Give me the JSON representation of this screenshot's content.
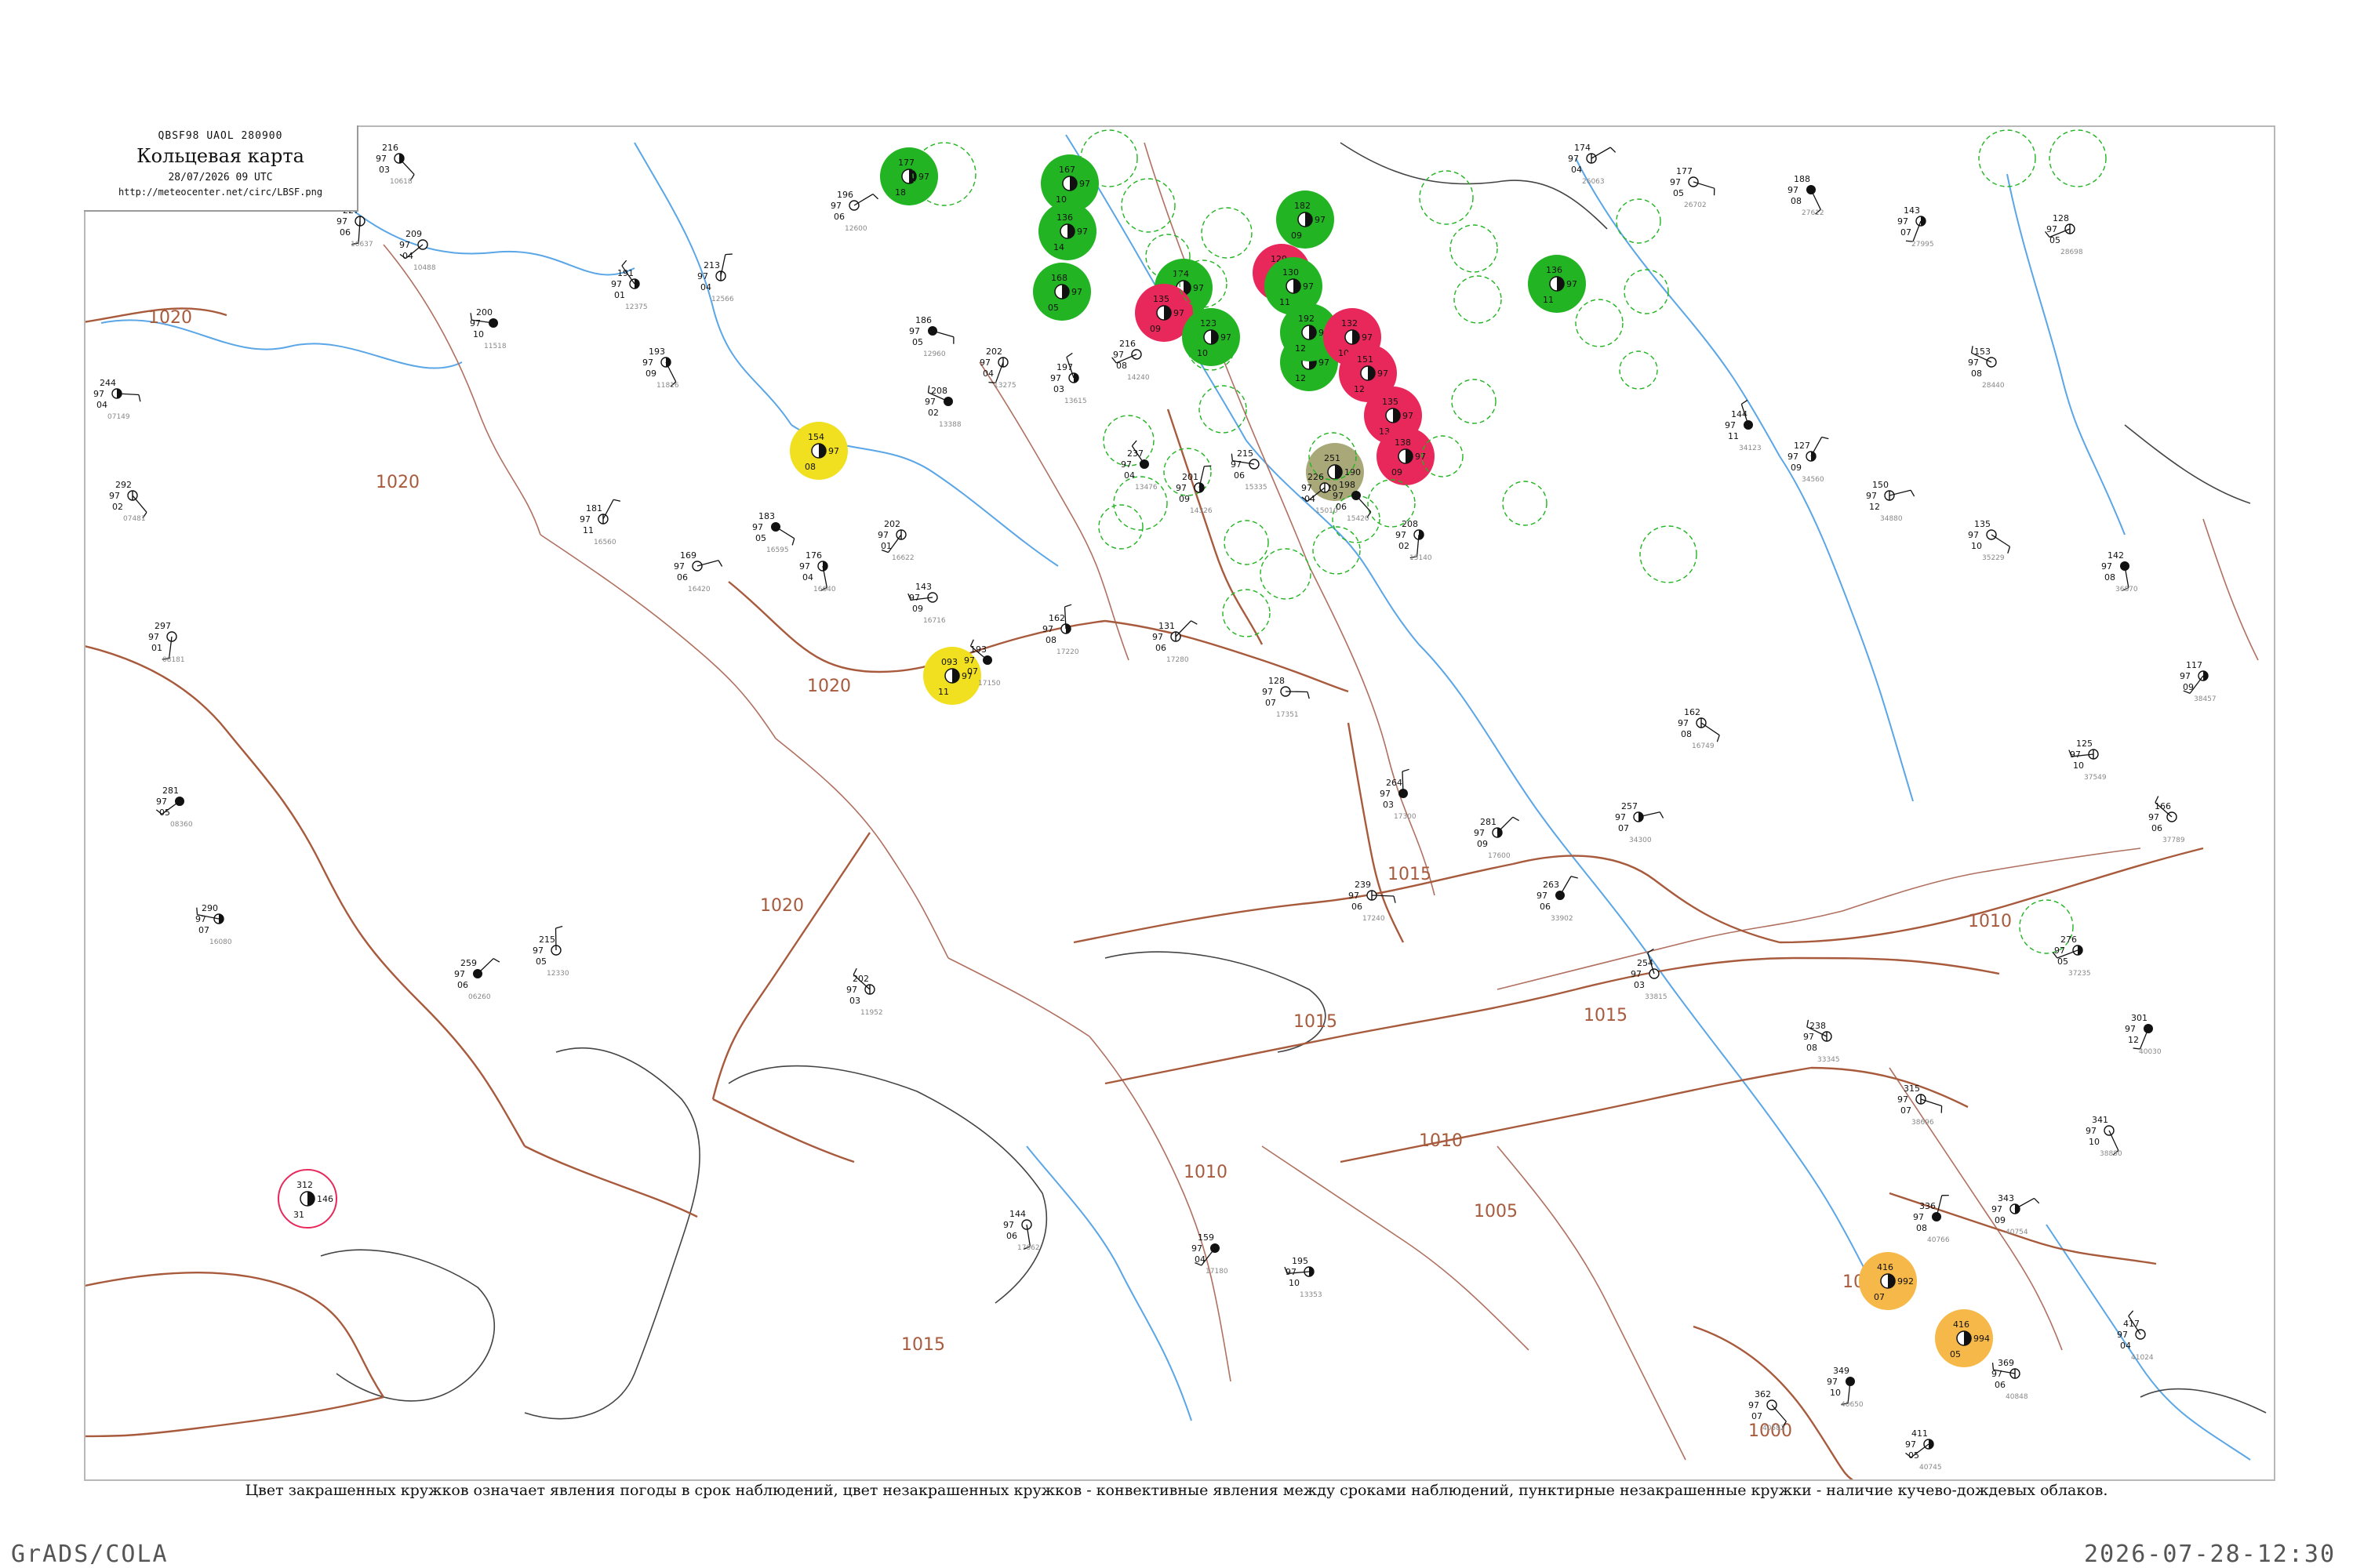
{
  "header": {
    "code": "QBSF98  UAOL  280900",
    "title": "Кольцевая карта",
    "datetime": "28/07/2026 09 UTC",
    "url": "http://meteocenter.net/circ/LBSF.png"
  },
  "legend": "Цвет закрашенных кружков означает явления погоды в срок наблюдений, цвет незакрашенных кружков - конвективные явления между сроками наблюдений, пунктирные незакрашенные кружки - наличие кучево-дождевых облаков.",
  "footer": {
    "left": "GrADS/COLA",
    "right": "2026-07-28-12:30"
  },
  "colors": {
    "rain": "#22b422",
    "thunderstorm": "#e8285a",
    "haze": "#f0e020",
    "dust": "#f6b848",
    "mist": "#a8a878",
    "isobar": "#a85a3c",
    "water": "#5aa6e6"
  },
  "isobar_labels": [
    "1020",
    "1020",
    "1020",
    "1020",
    "1015",
    "1015",
    "1015",
    "1015",
    "1015",
    "1010",
    "1010",
    "1010",
    "1010",
    "1005",
    "1000",
    "1000"
  ],
  "weather_markers": [
    {
      "type": "rain",
      "style": "filled",
      "values": [
        "177",
        "97",
        "18"
      ]
    },
    {
      "type": "rain",
      "style": "filled",
      "values": [
        "167",
        "97",
        "10"
      ]
    },
    {
      "type": "rain",
      "style": "filled",
      "values": [
        "182",
        "97",
        "09"
      ]
    },
    {
      "type": "rain",
      "style": "filled",
      "values": [
        "136",
        "97",
        "14"
      ]
    },
    {
      "type": "rain",
      "style": "filled",
      "values": [
        "168",
        "97",
        "05"
      ]
    },
    {
      "type": "thunderstorm",
      "style": "filled",
      "values": [
        "129",
        "97",
        "13"
      ]
    },
    {
      "type": "rain",
      "style": "filled",
      "values": [
        "161",
        "97",
        "12"
      ]
    },
    {
      "type": "rain",
      "style": "filled",
      "values": [
        "174",
        "97",
        "11"
      ]
    },
    {
      "type": "rain",
      "style": "filled",
      "values": [
        "136",
        "97",
        "11"
      ]
    },
    {
      "type": "thunderstorm",
      "style": "filled",
      "values": [
        "135",
        "97",
        "09"
      ]
    },
    {
      "type": "rain",
      "style": "filled",
      "values": [
        "123",
        "97",
        "10"
      ]
    },
    {
      "type": "rain",
      "style": "filled",
      "values": [
        "192",
        "97",
        "12"
      ]
    },
    {
      "type": "haze",
      "style": "filled",
      "values": [
        "154",
        "97",
        "08"
      ]
    },
    {
      "type": "rain",
      "style": "filled",
      "values": [
        "130",
        "97",
        "11"
      ]
    },
    {
      "type": "thunderstorm",
      "style": "filled",
      "values": [
        "132",
        "97",
        "10"
      ]
    },
    {
      "type": "thunderstorm",
      "style": "filled",
      "values": [
        "151",
        "97",
        "12"
      ]
    },
    {
      "type": "thunderstorm",
      "style": "filled",
      "values": [
        "135",
        "97",
        "13"
      ]
    },
    {
      "type": "thunderstorm",
      "style": "filled",
      "values": [
        "138",
        "97",
        "09"
      ]
    },
    {
      "type": "haze",
      "style": "filled",
      "values": [
        "093",
        "97",
        "11"
      ]
    },
    {
      "type": "mist",
      "style": "filled",
      "values": [
        "251",
        "190",
        "120"
      ]
    },
    {
      "type": "dust",
      "style": "filled",
      "values": [
        "416",
        "992",
        "07"
      ]
    },
    {
      "type": "dust",
      "style": "filled",
      "values": [
        "416",
        "994",
        "05"
      ]
    },
    {
      "type": "thunderstorm",
      "style": "outline",
      "values": [
        "312",
        "146",
        "31"
      ]
    }
  ],
  "stations": [
    {
      "name": "10405",
      "values": [
        "206",
        "97",
        "06"
      ]
    },
    {
      "name": "10618",
      "values": [
        "216",
        "97",
        "03"
      ]
    },
    {
      "name": "10637",
      "values": [
        "227",
        "97",
        "06"
      ]
    },
    {
      "name": "10488",
      "values": [
        "209",
        "97",
        "04"
      ]
    },
    {
      "name": "11518",
      "values": [
        "200",
        "97",
        "10"
      ]
    },
    {
      "name": "12375",
      "values": [
        "191",
        "97",
        "01"
      ]
    },
    {
      "name": "12566",
      "values": [
        "213",
        "97",
        "04"
      ]
    },
    {
      "name": "12600",
      "values": [
        "196",
        "97",
        "06"
      ]
    },
    {
      "name": "12960",
      "values": [
        "186",
        "97",
        "05"
      ]
    },
    {
      "name": "11816",
      "values": [
        "193",
        "97",
        "09"
      ]
    },
    {
      "name": "13275",
      "values": [
        "202",
        "97",
        "04"
      ]
    },
    {
      "name": "14240",
      "values": [
        "216",
        "97",
        "08"
      ]
    },
    {
      "name": "13388",
      "values": [
        "208",
        "97",
        "02"
      ]
    },
    {
      "name": "13615",
      "values": [
        "197",
        "97",
        "03"
      ]
    },
    {
      "name": "16560",
      "values": [
        "181",
        "97",
        "11"
      ]
    },
    {
      "name": "16420",
      "values": [
        "169",
        "97",
        "06"
      ]
    },
    {
      "name": "16595",
      "values": [
        "183",
        "97",
        "05"
      ]
    },
    {
      "name": "16640",
      "values": [
        "176",
        "97",
        "04"
      ]
    },
    {
      "name": "16622",
      "values": [
        "202",
        "97",
        "01"
      ]
    },
    {
      "name": "16716",
      "values": [
        "143",
        "97",
        "09"
      ]
    },
    {
      "name": "17150",
      "values": [
        "193",
        "97",
        "07"
      ]
    },
    {
      "name": "17220",
      "values": [
        "162",
        "97",
        "08"
      ]
    },
    {
      "name": "17280",
      "values": [
        "131",
        "97",
        "06"
      ]
    },
    {
      "name": "17351",
      "values": [
        "128",
        "97",
        "07"
      ]
    },
    {
      "name": "15420",
      "values": [
        "198",
        "97",
        "06"
      ]
    },
    {
      "name": "15140",
      "values": [
        "208",
        "97",
        "02"
      ]
    },
    {
      "name": "15010",
      "values": [
        "226",
        "97",
        "04"
      ]
    },
    {
      "name": "15335",
      "values": [
        "215",
        "97",
        "06"
      ]
    },
    {
      "name": "13476",
      "values": [
        "237",
        "97",
        "04"
      ]
    },
    {
      "name": "14326",
      "values": [
        "201",
        "97",
        "09"
      ]
    },
    {
      "name": "26063",
      "values": [
        "174",
        "97",
        "04"
      ]
    },
    {
      "name": "26702",
      "values": [
        "177",
        "97",
        "05"
      ]
    },
    {
      "name": "27612",
      "values": [
        "188",
        "97",
        "08"
      ]
    },
    {
      "name": "27995",
      "values": [
        "143",
        "97",
        "07"
      ]
    },
    {
      "name": "28698",
      "values": [
        "128",
        "97",
        "05"
      ]
    },
    {
      "name": "28440",
      "values": [
        "153",
        "97",
        "08"
      ]
    },
    {
      "name": "34123",
      "values": [
        "144",
        "97",
        "11"
      ]
    },
    {
      "name": "34560",
      "values": [
        "127",
        "97",
        "09"
      ]
    },
    {
      "name": "34880",
      "values": [
        "150",
        "97",
        "12"
      ]
    },
    {
      "name": "35229",
      "values": [
        "135",
        "97",
        "10"
      ]
    },
    {
      "name": "36870",
      "values": [
        "142",
        "97",
        "08"
      ]
    },
    {
      "name": "38457",
      "values": [
        "117",
        "97",
        "09"
      ]
    },
    {
      "name": "37549",
      "values": [
        "125",
        "97",
        "10"
      ]
    },
    {
      "name": "37789",
      "values": [
        "166",
        "97",
        "06"
      ]
    },
    {
      "name": "17300",
      "values": [
        "264",
        "97",
        "03"
      ]
    },
    {
      "name": "17600",
      "values": [
        "281",
        "97",
        "09"
      ]
    },
    {
      "name": "17240",
      "values": [
        "239",
        "97",
        "06"
      ]
    },
    {
      "name": "40582",
      "values": [
        "362",
        "97",
        "07"
      ]
    },
    {
      "name": "40650",
      "values": [
        "349",
        "97",
        "10"
      ]
    },
    {
      "name": "40745",
      "values": [
        "411",
        "97",
        "05"
      ]
    },
    {
      "name": "40848",
      "values": [
        "369",
        "97",
        "06"
      ]
    },
    {
      "name": "41024",
      "values": [
        "417",
        "97",
        "04"
      ]
    },
    {
      "name": "40766",
      "values": [
        "336",
        "97",
        "08"
      ]
    },
    {
      "name": "40754",
      "values": [
        "343",
        "97",
        "09"
      ]
    },
    {
      "name": "38696",
      "values": [
        "315",
        "97",
        "07"
      ]
    },
    {
      "name": "38880",
      "values": [
        "341",
        "97",
        "10"
      ]
    },
    {
      "name": "40030",
      "values": [
        "301",
        "97",
        "12"
      ]
    },
    {
      "name": "37235",
      "values": [
        "276",
        "97",
        "05"
      ]
    },
    {
      "name": "33345",
      "values": [
        "238",
        "97",
        "08"
      ]
    },
    {
      "name": "33815",
      "values": [
        "254",
        "97",
        "03"
      ]
    },
    {
      "name": "33902",
      "values": [
        "263",
        "97",
        "06"
      ]
    },
    {
      "name": "34300",
      "values": [
        "257",
        "97",
        "07"
      ]
    },
    {
      "name": "16749",
      "values": [
        "162",
        "97",
        "08"
      ]
    },
    {
      "name": "17062",
      "values": [
        "144",
        "97",
        "06"
      ]
    },
    {
      "name": "17180",
      "values": [
        "159",
        "97",
        "04"
      ]
    },
    {
      "name": "13353",
      "values": [
        "195",
        "97",
        "10"
      ]
    },
    {
      "name": "11952",
      "values": [
        "202",
        "97",
        "03"
      ]
    },
    {
      "name": "12330",
      "values": [
        "215",
        "97",
        "05"
      ]
    },
    {
      "name": "06260",
      "values": [
        "259",
        "97",
        "06"
      ]
    },
    {
      "name": "07149",
      "values": [
        "244",
        "97",
        "04"
      ]
    },
    {
      "name": "07481",
      "values": [
        "292",
        "97",
        "02"
      ]
    },
    {
      "name": "08181",
      "values": [
        "297",
        "97",
        "01"
      ]
    },
    {
      "name": "08360",
      "values": [
        "281",
        "97",
        "05"
      ]
    },
    {
      "name": "16080",
      "values": [
        "290",
        "97",
        "07"
      ]
    }
  ]
}
